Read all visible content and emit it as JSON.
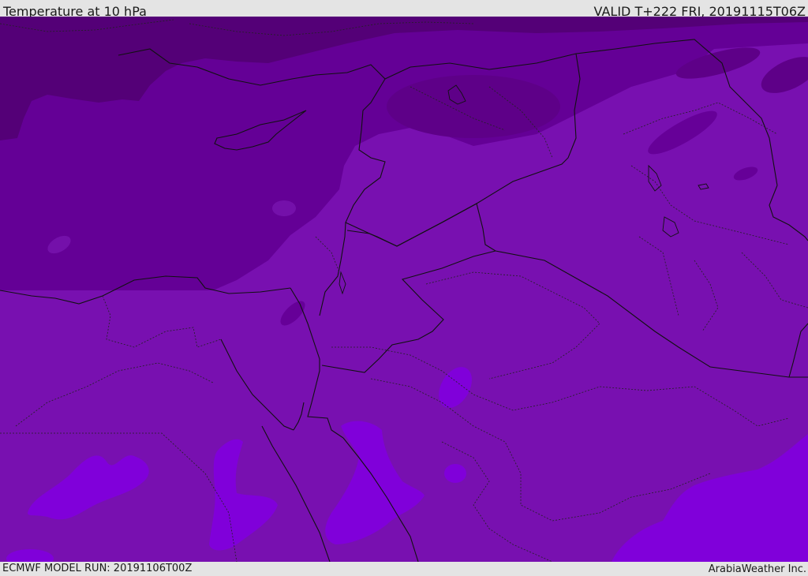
{
  "header": {
    "title": "Temperature at 10 hPa",
    "valid": "VALID T+222 FRI, 20191115T06Z"
  },
  "footer": {
    "model_run": "ECMWF MODEL RUN: 20191106T00Z",
    "credit": "ArabiaWeather Inc."
  },
  "map": {
    "variable": "temperature",
    "pressure_level": "10 hPa",
    "colors": {
      "coldest": "#540077",
      "cold": "#640096",
      "mid": "#7810b0",
      "warm": "#8000da",
      "warmest": "#8a10e8",
      "boundary": "#111111"
    }
  }
}
